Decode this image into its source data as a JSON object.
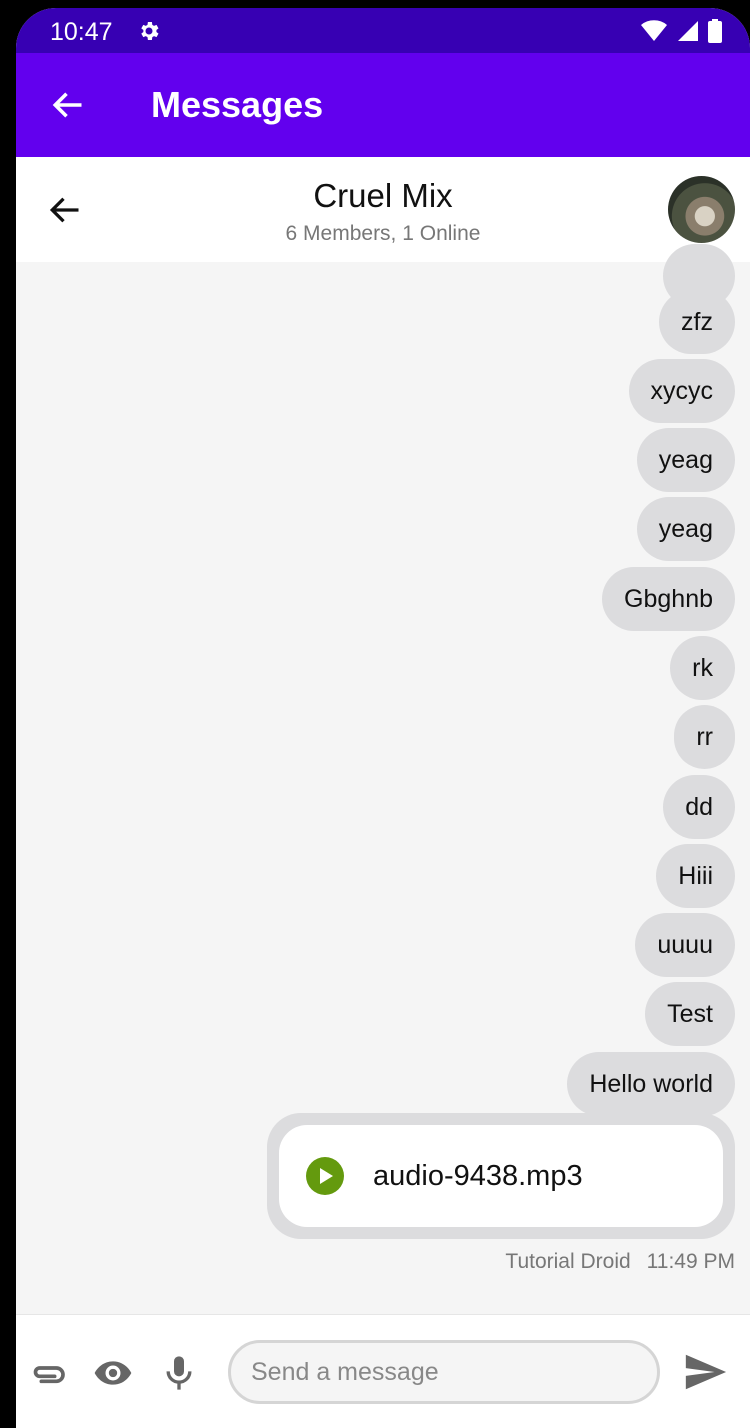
{
  "status_bar": {
    "time": "10:47"
  },
  "app_bar": {
    "title": "Messages"
  },
  "chat_header": {
    "title": "Cruel Mix",
    "subtitle": "6 Members, 1 Online"
  },
  "messages": [
    {
      "text": "zfz"
    },
    {
      "text": "xycyc"
    },
    {
      "text": "yeag"
    },
    {
      "text": "yeag"
    },
    {
      "text": "Gbghnb"
    },
    {
      "text": "rk"
    },
    {
      "text": "rr"
    },
    {
      "text": "dd"
    },
    {
      "text": "Hiii"
    },
    {
      "text": "uuuu"
    },
    {
      "text": "Test"
    },
    {
      "text": "Hello world"
    }
  ],
  "audio_message": {
    "file_name": "audio-9438.mp3",
    "sender": "Tutorial Droid",
    "time": "11:49 PM"
  },
  "composer": {
    "placeholder": "Send a message"
  },
  "colors": {
    "status_bar": "#3700b3",
    "app_bar": "#6200ee",
    "bubble": "#dcdcde",
    "play_button": "#649a0e",
    "background": "#f5f5f5"
  },
  "icons": [
    "settings-gear-icon",
    "wifi-icon",
    "signal-icon",
    "battery-icon",
    "back-arrow-icon",
    "attachment-icon",
    "eye-icon",
    "microphone-icon",
    "send-icon",
    "play-icon"
  ]
}
